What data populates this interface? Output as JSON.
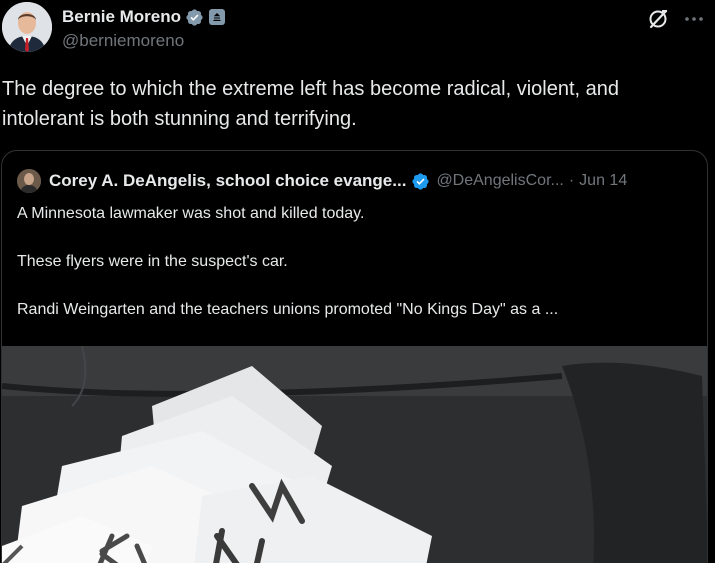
{
  "post": {
    "author_name": "Bernie Moreno",
    "author_handle": "@berniemoreno",
    "text": "The degree to which the extreme left has become radical, violent, and intolerant is both stunning and terrifying."
  },
  "quote": {
    "author_name": "Corey A. DeAngelis, school choice evange...",
    "author_handle": "@DeAngelisCor...",
    "separator": "·",
    "date": "Jun 14",
    "paragraphs": [
      "A Minnesota lawmaker was shot and killed today.",
      "These flyers were in the suspect's car.",
      "Randi Weingarten and the teachers unions promoted \"No Kings Day\" as a ..."
    ]
  },
  "icons": {
    "verified": "verified-badge-icon",
    "government": "government-badge-icon",
    "grok": "grok-icon",
    "more": "more-icon"
  },
  "colors": {
    "background": "#000000",
    "text": "#e7e9ea",
    "secondary_text": "#71767b",
    "verified_blue": "#1d9bf0",
    "verified_gray": "#829aab",
    "border": "#2f3336"
  }
}
